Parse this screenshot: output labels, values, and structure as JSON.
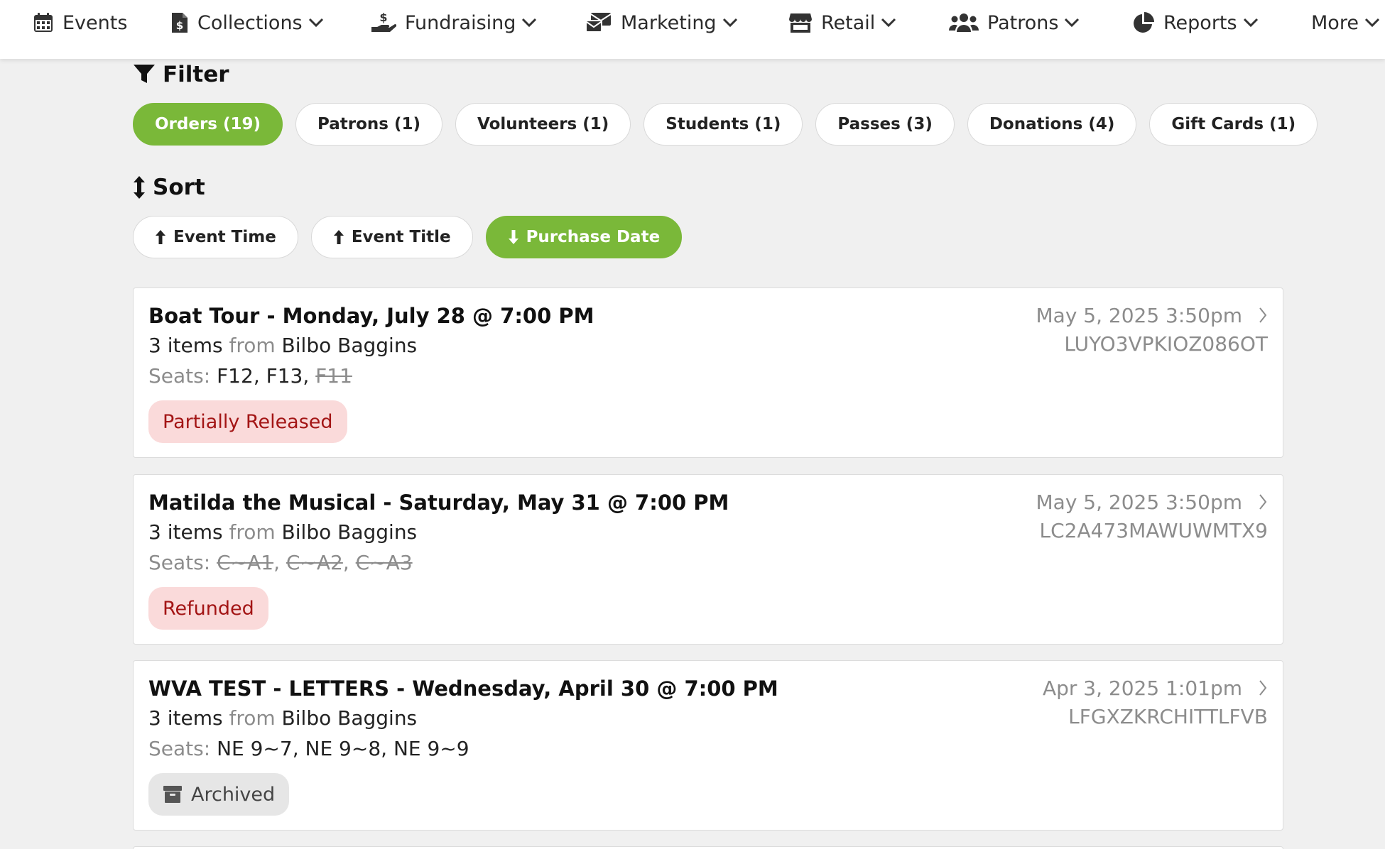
{
  "nav": {
    "items": [
      {
        "label": "Events",
        "icon": "calendar-icon",
        "dropdown": false
      },
      {
        "label": "Collections",
        "icon": "invoice-dollar-icon",
        "dropdown": true
      },
      {
        "label": "Fundraising",
        "icon": "hand-holding-dollar-icon",
        "dropdown": true
      },
      {
        "label": "Marketing",
        "icon": "mail-bulk-icon",
        "dropdown": true
      },
      {
        "label": "Retail",
        "icon": "store-icon",
        "dropdown": true
      },
      {
        "label": "Patrons",
        "icon": "users-icon",
        "dropdown": true
      },
      {
        "label": "Reports",
        "icon": "pie-chart-icon",
        "dropdown": true
      },
      {
        "label": "More",
        "icon": "",
        "dropdown": true
      }
    ]
  },
  "filter": {
    "heading": "Filter",
    "icon": "filter-icon",
    "pills": [
      {
        "label": "Orders (19)",
        "active": true
      },
      {
        "label": "Patrons (1)",
        "active": false
      },
      {
        "label": "Volunteers (1)",
        "active": false
      },
      {
        "label": "Students (1)",
        "active": false
      },
      {
        "label": "Passes (3)",
        "active": false
      },
      {
        "label": "Donations (4)",
        "active": false
      },
      {
        "label": "Gift Cards (1)",
        "active": false
      }
    ]
  },
  "sort": {
    "heading": "Sort",
    "icon": "sort-vertical-icon",
    "pills": [
      {
        "label": "Event Time",
        "direction": "up",
        "active": false
      },
      {
        "label": "Event Title",
        "direction": "up",
        "active": false
      },
      {
        "label": "Purchase Date",
        "direction": "down",
        "active": true
      }
    ]
  },
  "orders": [
    {
      "title": "Boat Tour - Monday, July 28 @ 7:00 PM",
      "items_count": "3 items",
      "from_label": "from",
      "patron": "Bilbo Baggins",
      "seats_label": "Seats:",
      "seats": [
        {
          "text": "F12, ",
          "released": false
        },
        {
          "text": "F13, ",
          "released": false
        },
        {
          "text": "F11",
          "released": true
        }
      ],
      "status": "Partially Released",
      "status_style": "red",
      "purchase_date": "May 5, 2025 3:50pm",
      "code": "LUYO3VPKIOZ086OT"
    },
    {
      "title": "Matilda the Musical - Saturday, May 31 @ 7:00 PM",
      "items_count": "3 items",
      "from_label": "from",
      "patron": "Bilbo Baggins",
      "seats_label": "Seats:",
      "seats": [
        {
          "text": "C~A1",
          "released": true
        },
        {
          "text": ", ",
          "released": false
        },
        {
          "text": "C~A2",
          "released": true
        },
        {
          "text": ", ",
          "released": false
        },
        {
          "text": "C~A3",
          "released": true
        }
      ],
      "status": "Refunded",
      "status_style": "red",
      "purchase_date": "May 5, 2025 3:50pm",
      "code": "LC2A473MAWUWMTX9"
    },
    {
      "title": "WVA TEST - LETTERS - Wednesday, April 30 @ 7:00 PM",
      "items_count": "3 items",
      "from_label": "from",
      "patron": "Bilbo Baggins",
      "seats_label": "Seats:",
      "seats": [
        {
          "text": "NE 9~7, ",
          "released": false
        },
        {
          "text": "NE 9~8, ",
          "released": false
        },
        {
          "text": "NE 9~9",
          "released": false
        }
      ],
      "status": "Archived",
      "status_style": "gray",
      "status_icon": "archive-box-icon",
      "purchase_date": "Apr 3, 2025 1:01pm",
      "code": "LFGXZKRCHITTLFVB"
    }
  ],
  "colors": {
    "accent_green": "#7ab839",
    "badge_red_bg": "#fadada",
    "badge_red_text": "#a31515",
    "badge_gray_bg": "#e6e6e6",
    "page_bg": "#f0f0f0"
  }
}
